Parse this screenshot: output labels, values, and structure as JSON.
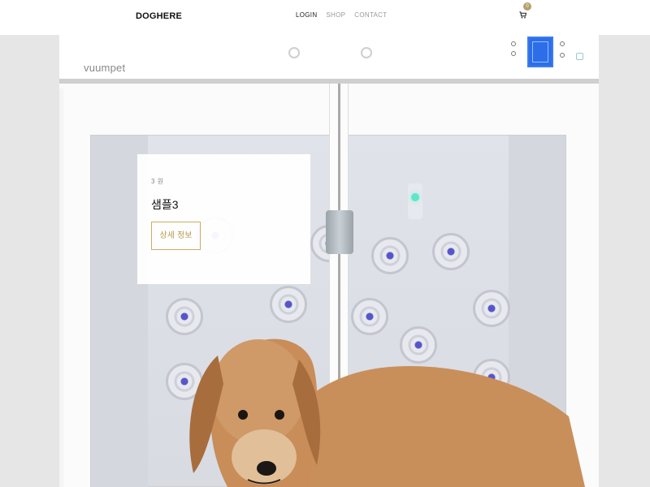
{
  "header": {
    "logo": "DOGHERE",
    "nav": [
      {
        "label": "LOGIN",
        "active": true
      },
      {
        "label": "SHOP",
        "active": false
      },
      {
        "label": "CONTACT",
        "active": false
      }
    ],
    "cart_count": "0"
  },
  "hero": {
    "product_brand": "vuumpet",
    "slide": {
      "price": "3 원",
      "title": "샘플3",
      "button_label": "상세 정보"
    }
  },
  "colors": {
    "accent": "#b5a06a",
    "button_border": "#c9ad63",
    "display_blue": "#2d6ee8"
  },
  "icons": [
    "cart-icon"
  ]
}
